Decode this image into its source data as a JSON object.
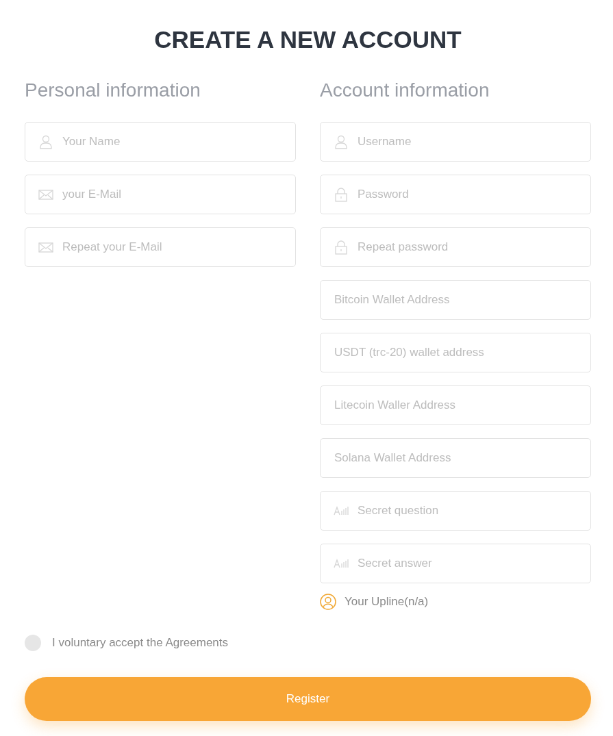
{
  "title": "CREATE A NEW ACCOUNT",
  "personal": {
    "heading": "Personal information",
    "fields": [
      {
        "kind": "user",
        "placeholder": "Your Name"
      },
      {
        "kind": "mail",
        "placeholder": "your E-Mail"
      },
      {
        "kind": "mail",
        "placeholder": "Repeat your E-Mail"
      }
    ]
  },
  "account": {
    "heading": "Account information",
    "fields": [
      {
        "kind": "user",
        "placeholder": "Username"
      },
      {
        "kind": "lock",
        "placeholder": "Password"
      },
      {
        "kind": "lock",
        "placeholder": "Repeat password"
      },
      {
        "kind": "plain",
        "placeholder": "Bitcoin Wallet Address"
      },
      {
        "kind": "plain",
        "placeholder": "USDT (trc-20) wallet address"
      },
      {
        "kind": "plain",
        "placeholder": "Litecoin Waller Address"
      },
      {
        "kind": "plain",
        "placeholder": "Solana Wallet Address"
      },
      {
        "kind": "text",
        "placeholder": "Secret question"
      },
      {
        "kind": "text",
        "placeholder": "Secret answer"
      }
    ],
    "upline": "Your Upline(n/a)"
  },
  "agreement": {
    "label": "I voluntary accept the Agreements",
    "checked": false
  },
  "register_button": "Register"
}
